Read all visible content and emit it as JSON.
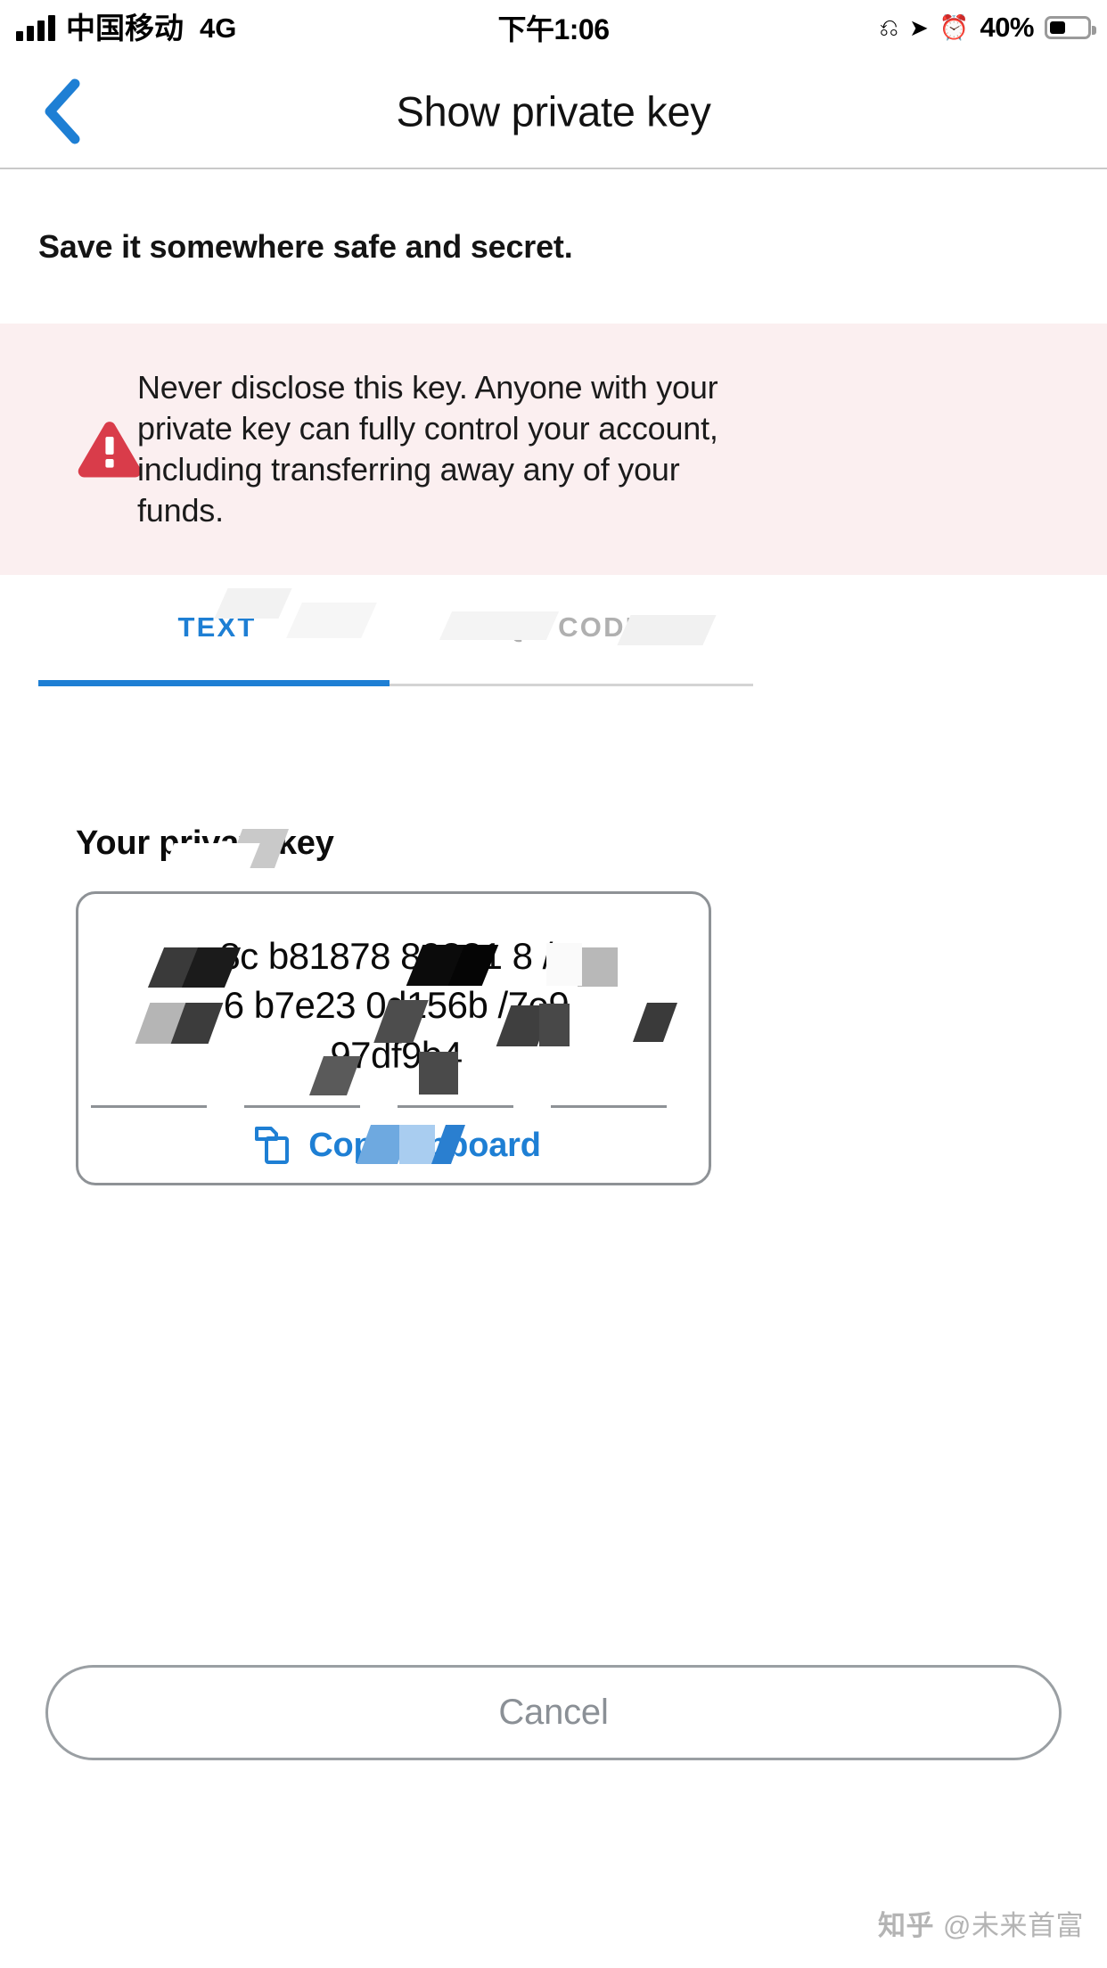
{
  "status_bar": {
    "carrier": "中国移动",
    "network": "4G",
    "time": "下午1:06",
    "battery_percent": "40%",
    "icons": [
      "signal-bars-icon",
      "lock-rotation-icon",
      "location-arrow-icon",
      "alarm-clock-icon",
      "battery-icon"
    ]
  },
  "header": {
    "title": "Show private key",
    "back_icon": "chevron-left-icon",
    "back_color": "#1e7fd4"
  },
  "subtitle": "Save it somewhere safe and secret.",
  "warning": {
    "icon": "warning-triangle-icon",
    "icon_color": "#d93c4a",
    "background": "#fbeff0",
    "text": "Never disclose this key. Anyone with your private key can fully control your account, including transferring away any of your funds."
  },
  "tabs": {
    "active_index": 0,
    "accent_color": "#1e7fd4",
    "inactive_color": "#b0b0b0",
    "items": [
      {
        "label": "TEXT"
      },
      {
        "label": "QR CODE"
      }
    ]
  },
  "key_panel": {
    "label": "Your private key",
    "key_text": "8c        b81878    80821 8   /3\n 6   b7e23    0d156b    /7e9\n        97df9b4",
    "copy": {
      "icon": "copy-icon",
      "label_left": "Copy",
      "label_right": "lipboard",
      "color": "#1e7fd4"
    }
  },
  "footer": {
    "cancel_label": "Cancel"
  },
  "watermark": {
    "logo": "知乎",
    "handle": "@未来首富"
  }
}
